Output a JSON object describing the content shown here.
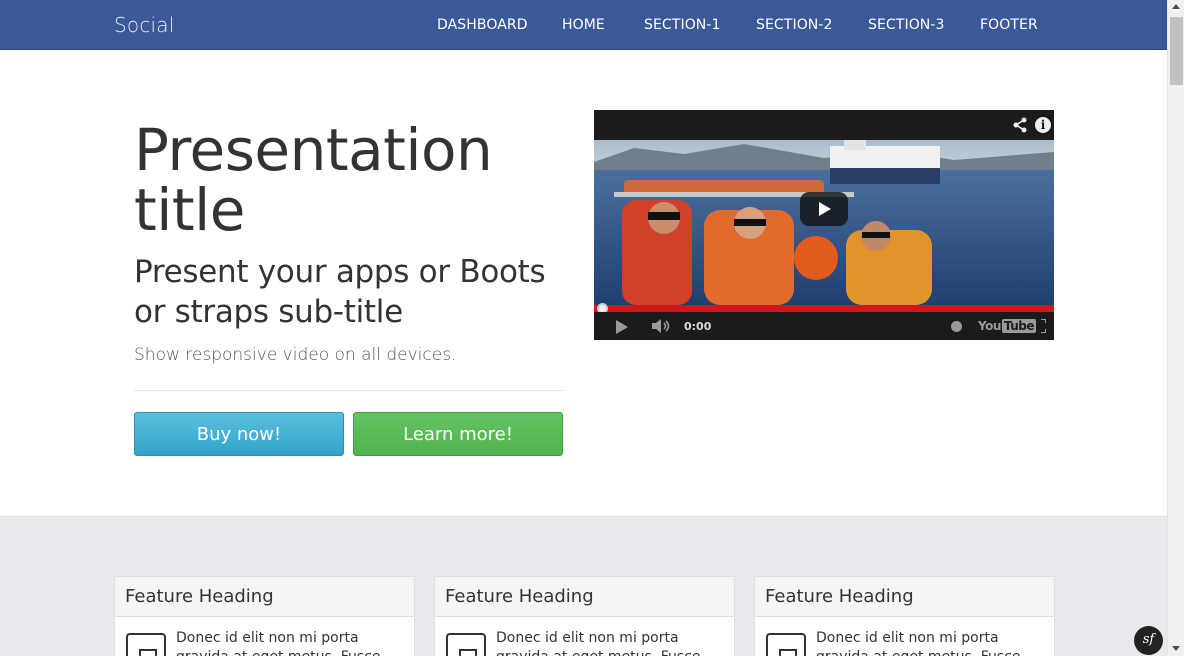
{
  "navbar": {
    "brand": "Social",
    "items": [
      {
        "label": "DASHBOARD"
      },
      {
        "label": "HOME"
      },
      {
        "label": "SECTION-1"
      },
      {
        "label": "SECTION-2"
      },
      {
        "label": "SECTION-3"
      },
      {
        "label": "FOOTER"
      }
    ]
  },
  "hero": {
    "title": "Presentation title",
    "subtitle": "Present your apps or Boots or straps sub-title",
    "lead": "Show responsive video on all devices.",
    "buy_label": "Buy now!",
    "learn_label": "Learn more!"
  },
  "video": {
    "time": "0:00",
    "youtube_logo_you": "You",
    "youtube_logo_tube": "Tube",
    "info_glyph": "i",
    "progress_fraction": 0.0
  },
  "features": [
    {
      "heading": "Feature Heading",
      "text": "Donec id elit non mi porta gravida at eget metus. Fusce"
    },
    {
      "heading": "Feature Heading",
      "text": "Donec id elit non mi porta gravida at eget metus. Fusce"
    },
    {
      "heading": "Feature Heading",
      "text": "Donec id elit non mi porta gravida at eget metus. Fusce"
    }
  ],
  "sf_badge": "sf",
  "colors": {
    "navbar": "#3b5998",
    "buy_button": "#5bc0de",
    "learn_button": "#5cb85c",
    "progress_bar": "#cc181e",
    "features_bg": "#e9eaed"
  },
  "icons": [
    "share-icon",
    "info-icon",
    "play-icon",
    "volume-icon",
    "clock-icon",
    "youtube-logo",
    "fullscreen-icon",
    "tablet-icon",
    "symfony-badge"
  ]
}
